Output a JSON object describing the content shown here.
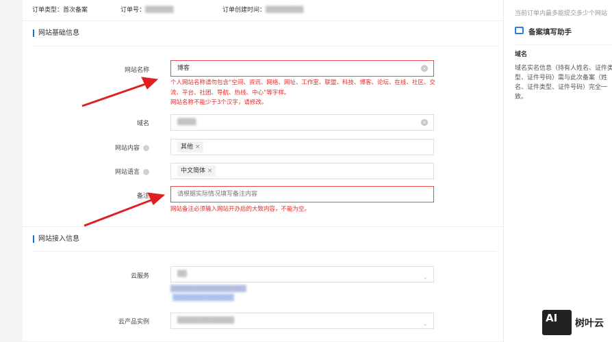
{
  "order": {
    "type_label": "订单类型：",
    "type_value": "首次备案",
    "no_label": "订单号：",
    "no_value": "▒▒▒▒▒▒",
    "time_label": "订单创建时间：",
    "time_value": "▒▒▒▒▒▒▒▒"
  },
  "section1": {
    "title": "网站基础信息",
    "site_name": {
      "label": "网站名称",
      "value": "博客",
      "error1": "个人网站名称请勿包含“空间、资讯、网络、网址、工作室、联盟、科技、博客、论坛、在线、社区、交流、平台、社团、导航、热线、中心”等字样。",
      "error2": "网站名称不能少于3个汉字，请修改。"
    },
    "domain": {
      "label": "域名",
      "value": "▒▒▒▒"
    },
    "content": {
      "label": "网站内容",
      "tag": "其他"
    },
    "language": {
      "label": "网站语言",
      "tag": "中文简体"
    },
    "remark": {
      "label": "备注",
      "placeholder": "请根据实际情况填写备注内容",
      "error": "网站备注必须输入网站开办后的大致内容，不能为空。"
    }
  },
  "section2": {
    "title": "网站接入信息",
    "cloud_service": {
      "label": "云服务",
      "value": "▒▒",
      "hint1": "▒▒▒▒▒▒▒▒▒▒▒▒▒▒▒▒",
      "hint2": "▒▒▒▒▒▒▒▒▒▒▒▒▒"
    },
    "instance": {
      "label": "云产品实例",
      "value": "▒▒▒▒▒▒▒▒▒▒▒▒"
    }
  },
  "assistant": {
    "top_note": "当前订单内最多能提交多少个网站",
    "title": "备案填写助手",
    "field": "域名",
    "desc": "域名实名信息（持有人姓名、证件类型、证件号码）需与此次备案（姓名、证件类型、证件号码）完全一致。"
  },
  "watermark": {
    "logo": "AI",
    "text": "树叶云"
  },
  "colors": {
    "error": "#e52b2b",
    "accent": "#1a6fd0",
    "arrow": "#e02020"
  }
}
